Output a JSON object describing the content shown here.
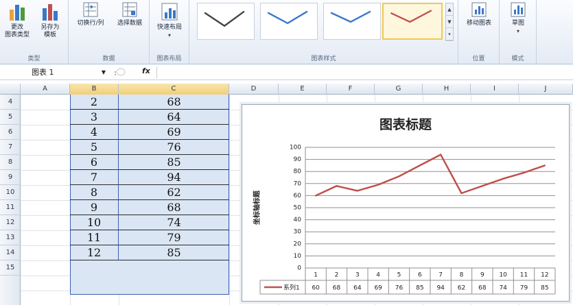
{
  "ribbon": {
    "groups": [
      {
        "label": "类型",
        "buttons": [
          {
            "label1": "更改",
            "label2": "图表类型"
          },
          {
            "label1": "另存为",
            "label2": "模板"
          }
        ]
      },
      {
        "label": "数据",
        "buttons": [
          {
            "label1": "切换行/列",
            "label2": ""
          },
          {
            "label1": "选择数据",
            "label2": ""
          }
        ]
      },
      {
        "label": "图表布局",
        "buttons": [
          {
            "label1": "快速布局",
            "label2": "▾"
          }
        ]
      },
      {
        "label": "图表样式"
      },
      {
        "label": "位置",
        "buttons": [
          {
            "label1": "移动图表",
            "label2": ""
          }
        ]
      },
      {
        "label": "模式",
        "buttons": [
          {
            "label1": "草图",
            "label2": "▾"
          }
        ]
      }
    ]
  },
  "formula_bar": {
    "name_box": "图表 1",
    "fx": "fx"
  },
  "columns": [
    "A",
    "B",
    "C",
    "D",
    "E",
    "F",
    "G",
    "H",
    "I",
    "J"
  ],
  "rows": [
    "4",
    "5",
    "6",
    "7",
    "8",
    "9",
    "10",
    "11",
    "12",
    "13",
    "14",
    "15"
  ],
  "table": {
    "b": [
      "2",
      "3",
      "4",
      "5",
      "6",
      "7",
      "8",
      "9",
      "10",
      "11",
      "12"
    ],
    "c": [
      "68",
      "64",
      "69",
      "76",
      "85",
      "94",
      "62",
      "68",
      "74",
      "79",
      "85"
    ]
  },
  "colors": {
    "series": "#c0504d",
    "selection": "#dbe6f4",
    "selection_border": "#3a5db5"
  },
  "chart_data": {
    "type": "line",
    "title": "图表标题",
    "ylabel": "坐标轴标题",
    "xlabel": "",
    "categories": [
      "1",
      "2",
      "3",
      "4",
      "5",
      "6",
      "7",
      "8",
      "9",
      "10",
      "11",
      "12"
    ],
    "series": [
      {
        "name": "系列1",
        "values": [
          60,
          68,
          64,
          69,
          76,
          85,
          94,
          62,
          68,
          74,
          79,
          85
        ]
      }
    ],
    "ylim": [
      0,
      100
    ],
    "yticks": [
      0,
      10,
      20,
      30,
      40,
      50,
      60,
      70,
      80,
      90,
      100
    ],
    "grid": true,
    "legend": "bottom data table"
  }
}
